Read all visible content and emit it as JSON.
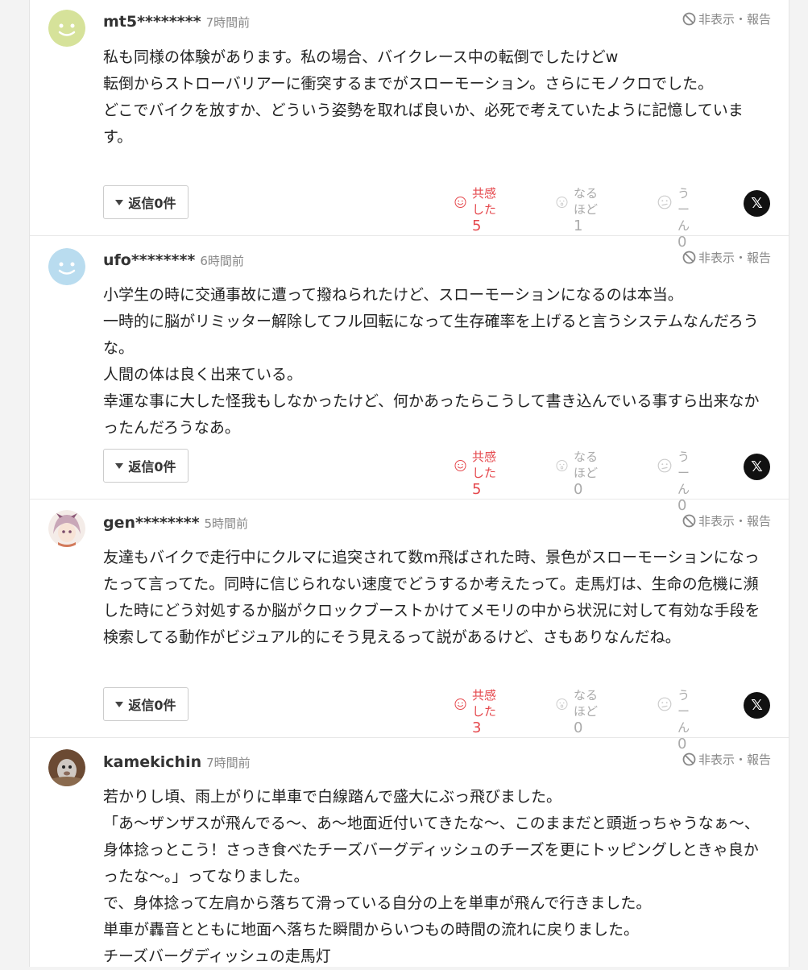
{
  "ui": {
    "hide_report": "非表示・報告",
    "reply_arrow": "▼"
  },
  "comments": [
    {
      "user": "mt5********",
      "time": "7時間前",
      "body": "私も同様の体験があります。私の場合、バイクレース中の転倒でしたけどw\n転倒からストローバリアーに衝突するまでがスローモーション。さらにモノクロでした。\nどこでバイクを放すか、どういう姿勢を取れば良いか、必死で考えていたように記憶しています。",
      "reply": "返信0件",
      "reactions": [
        {
          "label": "共感した",
          "count": "5"
        },
        {
          "label": "なるほど",
          "count": "1"
        },
        {
          "label": "うーん",
          "count": "0"
        }
      ],
      "avatar_color": "#d6e29a"
    },
    {
      "user": "ufo********",
      "time": "6時間前",
      "body": "小学生の時に交通事故に遭って撥ねられたけど、スローモーションになるのは本当。\n一時的に脳がリミッター解除してフル回転になって生存確率を上げると言うシステムなんだろうな。\n人間の体は良く出来ている。\n幸運な事に大した怪我もしなかったけど、何かあったらこうして書き込んでいる事すら出来なかったんだろうなあ。",
      "reply": "返信0件",
      "reactions": [
        {
          "label": "共感した",
          "count": "5"
        },
        {
          "label": "なるほど",
          "count": "0"
        },
        {
          "label": "うーん",
          "count": "0"
        }
      ],
      "avatar_color": "#b9dcef"
    },
    {
      "user": "gen********",
      "time": "5時間前",
      "body": "友達もバイクで走行中にクルマに追突されて数m飛ばされた時、景色がスローモーションになったって言ってた。同時に信じられない速度でどうするか考えたって。走馬灯は、生命の危機に瀕した時にどう対処するか脳がクロックブーストかけてメモリの中から状況に対して有効な手段を検索してる動作がビジュアル的にそう見えるって説があるけど、さもありなんだね。",
      "reply": "返信0件",
      "reactions": [
        {
          "label": "共感した",
          "count": "3"
        },
        {
          "label": "なるほど",
          "count": "0"
        },
        {
          "label": "うーん",
          "count": "0"
        }
      ],
      "avatar_color": "#c9a7b8"
    },
    {
      "user": "kamekichin",
      "time": "7時間前",
      "body": "若かりし頃、雨上がりに単車で白線踏んで盛大にぶっ飛びました。\n「あ〜ザンザスが飛んでる〜、あ〜地面近付いてきたな〜、このままだと頭逝っちゃうなぁ〜、身体捻っとこう！さっき食べたチーズバーグディッシュのチーズを更にトッピングしときゃ良かったな〜。」ってなりました。\nで、身体捻って左肩から落ちて滑っている自分の上を単車が飛んで行きました。\n単車が轟音とともに地面へ落ちた瞬間からいつもの時間の流れに戻りました。\nチーズバーグディッシュの走馬灯",
      "avatar_color": "#8a6a4e"
    }
  ]
}
